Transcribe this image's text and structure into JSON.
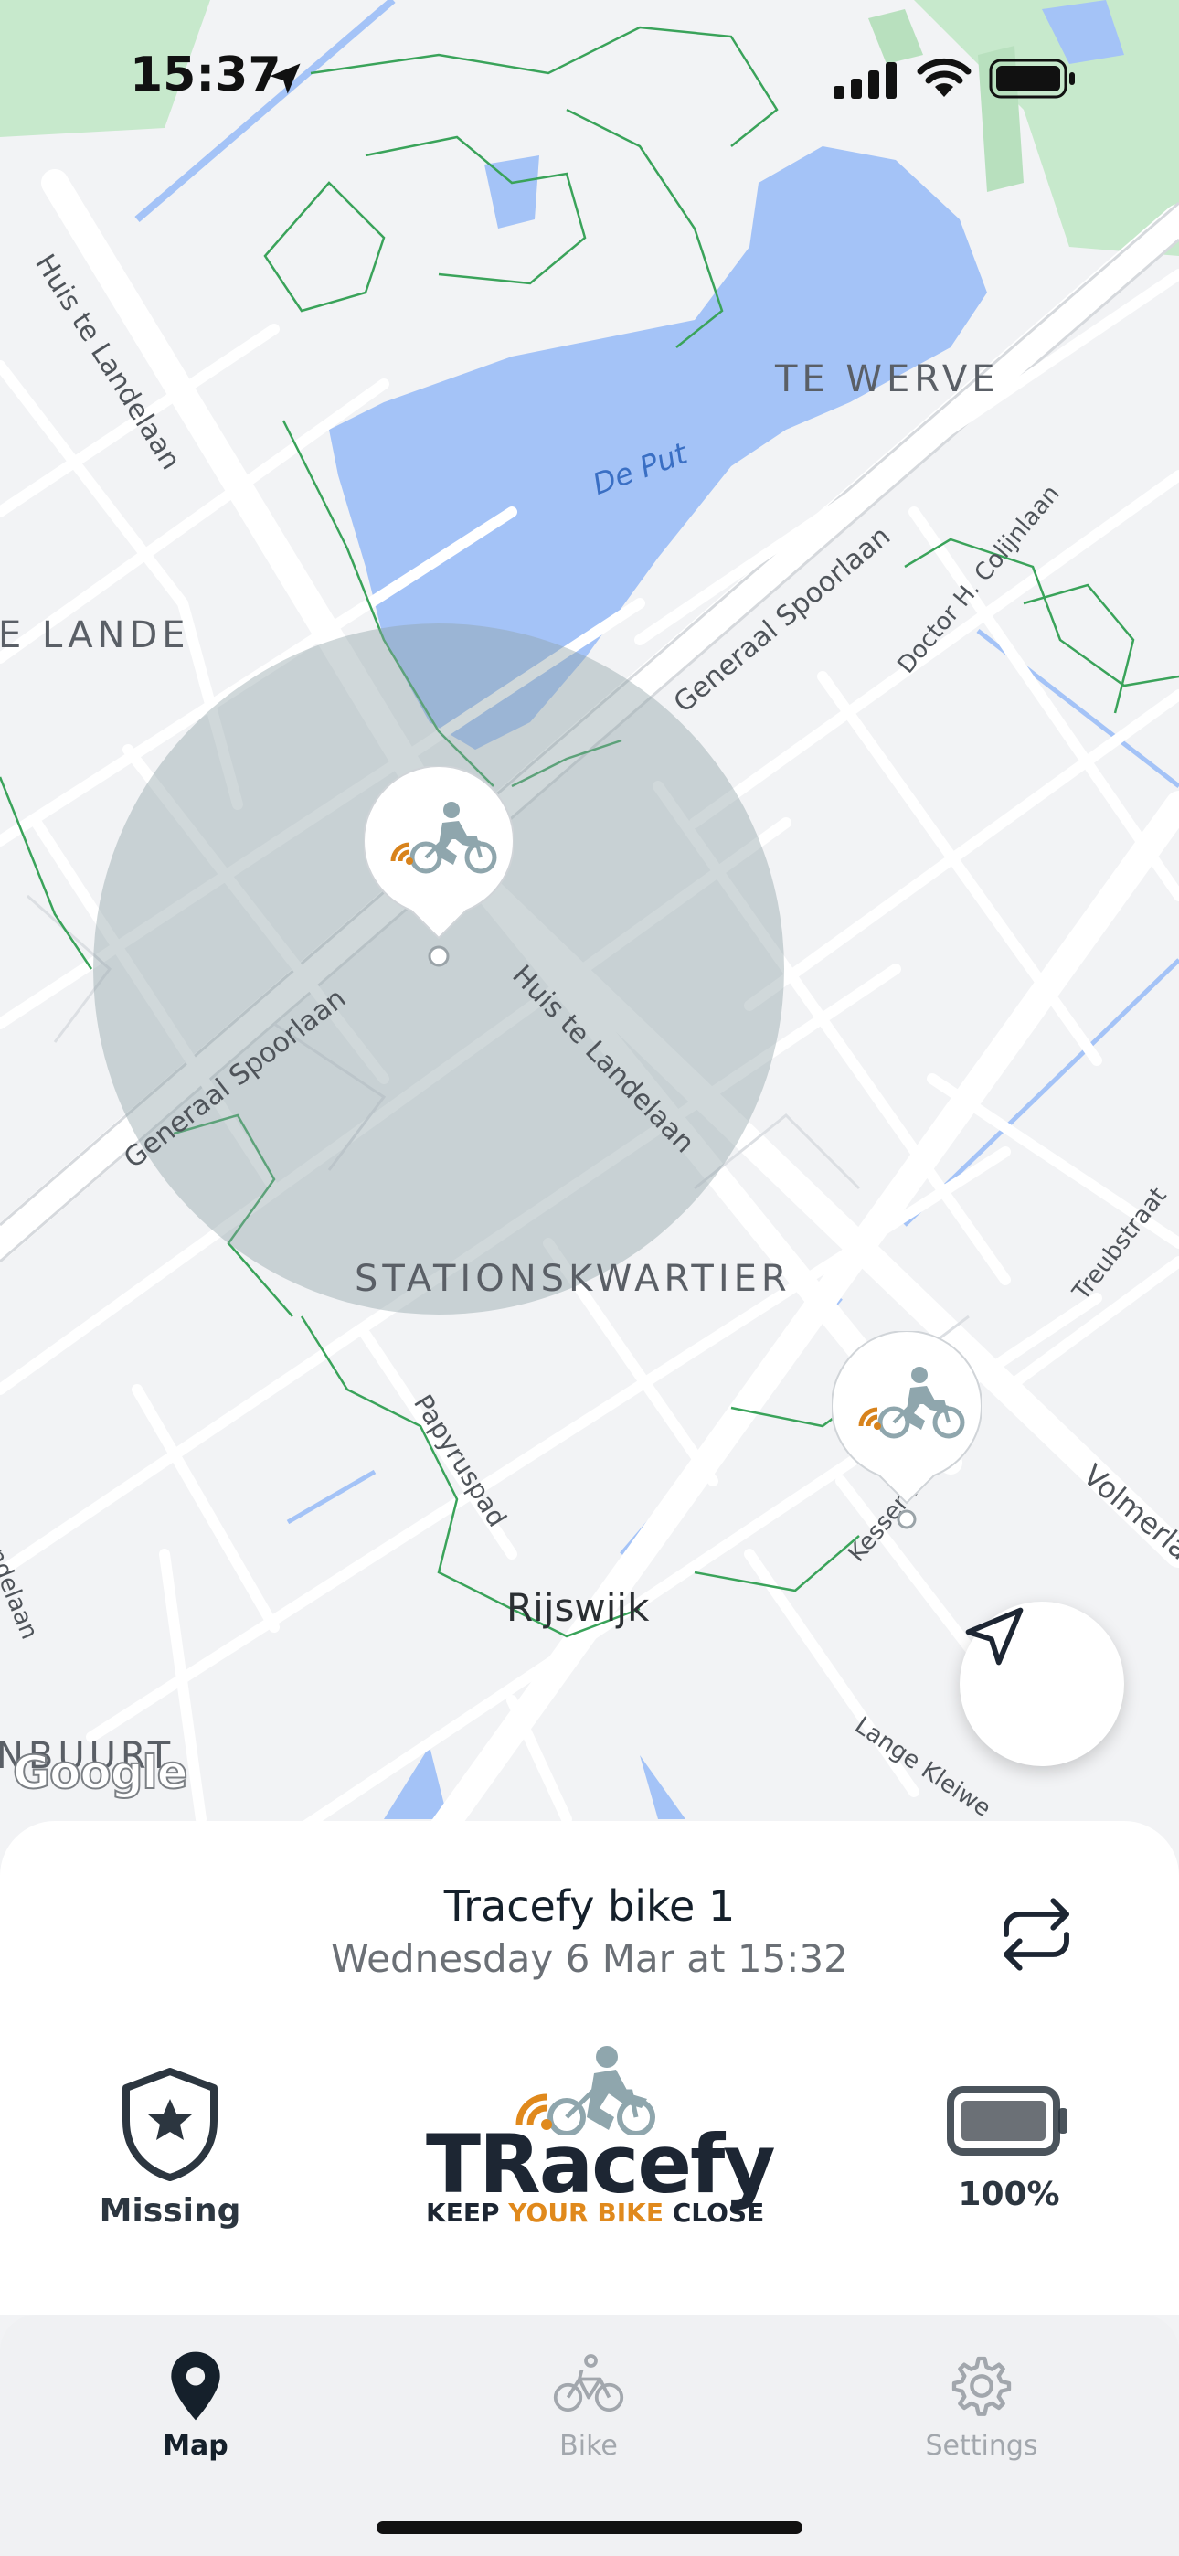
{
  "status_bar": {
    "time": "15:37"
  },
  "map": {
    "district_labels": {
      "te_werve": "TE WERVE",
      "lande": "E LANDE",
      "stationskwartier": "STATIONSKWARTIER",
      "nbuurt": "NBUURT"
    },
    "water_label": "De Put",
    "street_labels": {
      "huis_te_landelaan_top": "Huis te Landelaan",
      "huis_te_landelaan_mid": "Huis te Landelaan",
      "generaal_spoorlaan_top": "Generaal Spoorlaan",
      "generaal_spoorlaan_left": "Generaal Spoorlaan",
      "doctor_colijnlaan": "Doctor H. Colijnlaan",
      "papyruspad": "Papyruspad",
      "treubstraat": "Treubstraat",
      "volmerlaan": "Volmerla",
      "kesser": "Kesser Pa",
      "lange_kleiweg": "Lange Kleiwe",
      "left_edge": "ndelaan"
    },
    "town_label": "Rijswijk",
    "attribution": "Google",
    "colors": {
      "water": "#a4c3f7",
      "park": "#c7e9cc",
      "accuracy_circle": "#8fa3a8",
      "marker_accent": "#d8831c",
      "bike_icon": "#8fa6ad"
    }
  },
  "bottom_sheet": {
    "bike_name": "Tracefy bike 1",
    "last_seen": "Wednesday 6 Mar at 15:32",
    "status_label": "Missing",
    "battery_label": "100%",
    "brand": {
      "word": "TRacefy",
      "tag_prefix": "KEEP ",
      "tag_accent": "YOUR BIKE",
      "tag_suffix": " CLOSE"
    }
  },
  "tabbar": {
    "tabs": [
      {
        "label": "Map",
        "icon": "map-pin-icon",
        "active": true
      },
      {
        "label": "Bike",
        "icon": "bike-icon",
        "active": false
      },
      {
        "label": "Settings",
        "icon": "gear-icon",
        "active": false
      }
    ]
  }
}
